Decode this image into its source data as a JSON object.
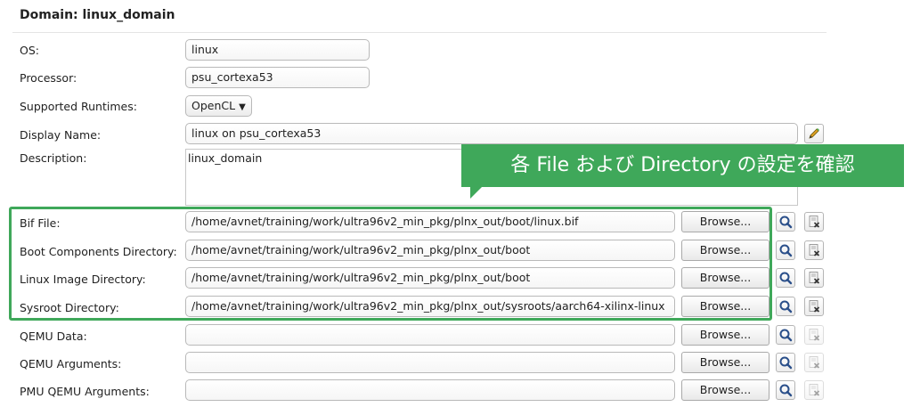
{
  "header": {
    "title": "Domain: linux_domain"
  },
  "os": {
    "label": "OS:",
    "value": "linux"
  },
  "processor": {
    "label": "Processor:",
    "value": "psu_cortexa53"
  },
  "runtimes": {
    "label": "Supported Runtimes:",
    "value": "OpenCL",
    "caret": "▼"
  },
  "display_name": {
    "label": "Display Name:",
    "value": "linux on psu_cortexa53"
  },
  "description": {
    "label": "Description:",
    "value": "linux_domain"
  },
  "callout": {
    "text": "各 File および Directory の設定を確認",
    "color": "#3fa85a"
  },
  "paths": [
    {
      "label": "Bif File:",
      "value": "/home/avnet/training/work/ultra96v2_min_pkg/plnx_out/boot/linux.bif",
      "browse": "Browse..."
    },
    {
      "label": "Boot Components Directory:",
      "value": "/home/avnet/training/work/ultra96v2_min_pkg/plnx_out/boot",
      "browse": "Browse..."
    },
    {
      "label": "Linux Image Directory:",
      "value": "/home/avnet/training/work/ultra96v2_min_pkg/plnx_out/boot",
      "browse": "Browse..."
    },
    {
      "label": "Sysroot Directory:",
      "value": "/home/avnet/training/work/ultra96v2_min_pkg/plnx_out/sysroots/aarch64-xilinx-linux",
      "browse": "Browse..."
    },
    {
      "label": "QEMU Data:",
      "value": "",
      "browse": "Browse..."
    },
    {
      "label": "QEMU Arguments:",
      "value": "",
      "browse": "Browse..."
    },
    {
      "label": "PMU QEMU Arguments:",
      "value": "",
      "browse": "Browse..."
    }
  ],
  "icons": {
    "search": "search-icon",
    "clear": "clear-icon",
    "edit": "pencil-icon"
  }
}
